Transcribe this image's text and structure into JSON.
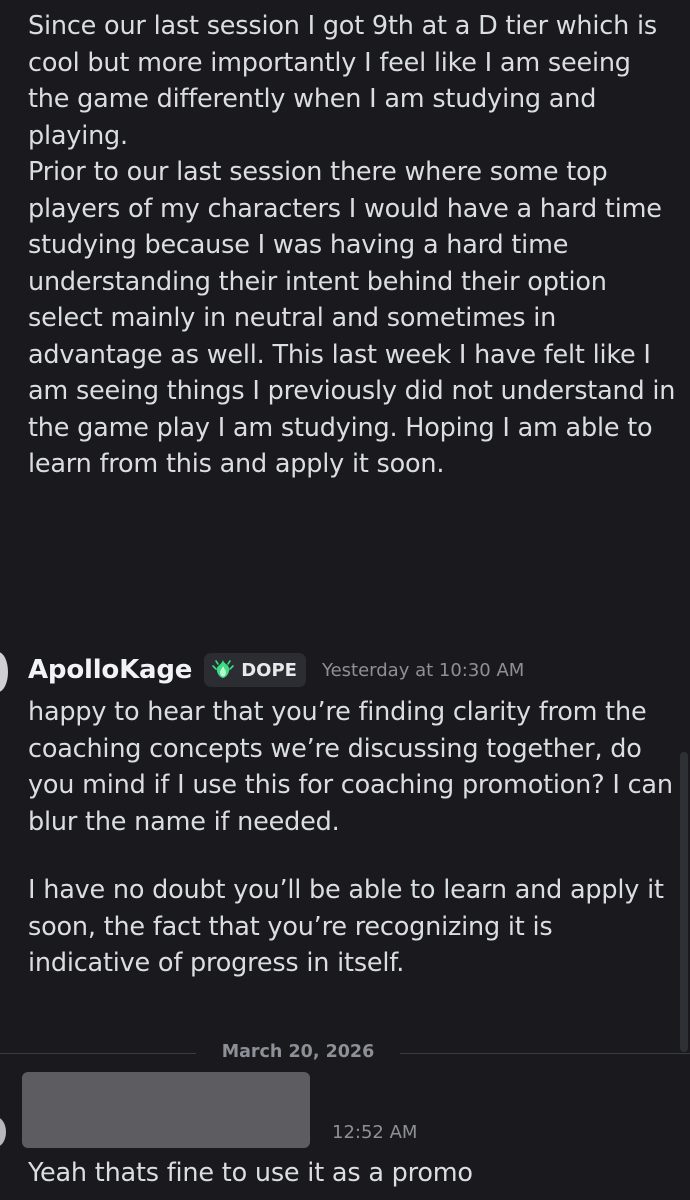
{
  "messages": {
    "first": {
      "text": "Since our last session I got 9th at a D tier which is cool but more importantly I feel like I am seeing the game differently when I am studying and playing.\nPrior to our last session there where some top players of my characters I would have a hard time studying because I was having a hard time understanding their intent behind their option select mainly in neutral and sometimes in advantage as well. This last week I have felt like I am seeing things I previously did not understand in the game play I am studying. Hoping I am able to learn from this and apply it soon."
    },
    "reply": {
      "username": "ApolloKage",
      "tag_icon": "flame-leaf-icon",
      "tag_label": "DOPE",
      "timestamp": "Yesterday at 10:30 AM",
      "text_1": "happy to hear that you’re finding clarity from the coaching concepts we’re discussing together, do you mind if I use this for coaching promotion? I can blur the name if needed.",
      "text_2": "I have no doubt you’ll be able to learn and apply it soon, the fact that you’re recognizing it is indicative of progress in itself."
    },
    "date_divider": "March 20, 2026",
    "last": {
      "timestamp": "12:52 AM",
      "text": "Yeah thats fine to use it as a promo"
    }
  },
  "colors": {
    "background": "#1a1a1e",
    "text": "#dbdee1",
    "muted": "#8e9097",
    "tag_bg": "#2b2d33",
    "tag_icon": "#3ddc84",
    "redaction": "#5d5d61"
  }
}
